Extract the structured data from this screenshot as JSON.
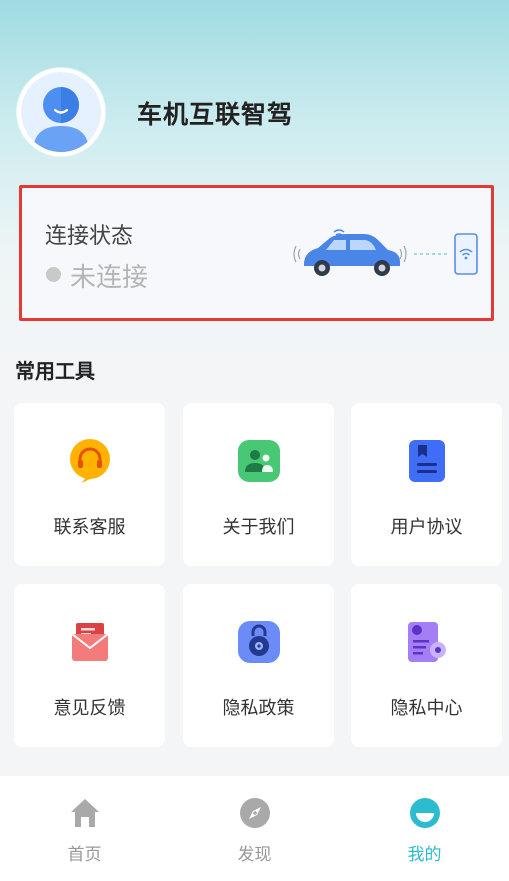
{
  "header": {
    "app_title": "车机互联智驾",
    "avatar_icon": "user-avatar-icon"
  },
  "connection": {
    "title": "连接状态",
    "status": "未连接",
    "status_color": "#c9c9c9"
  },
  "tools": {
    "section_title": "常用工具",
    "items": [
      {
        "label": "联系客服",
        "icon": "headset-icon",
        "color": "#ffb300"
      },
      {
        "label": "关于我们",
        "icon": "people-icon",
        "color": "#3fbf6f"
      },
      {
        "label": "用户协议",
        "icon": "bookmark-document-icon",
        "color": "#3f6df6"
      },
      {
        "label": "意见反馈",
        "icon": "envelope-icon",
        "color": "#f05454"
      },
      {
        "label": "隐私政策",
        "icon": "lock-icon",
        "color": "#5b7cf6"
      },
      {
        "label": "隐私中心",
        "icon": "privacy-settings-icon",
        "color": "#9a6ff2"
      }
    ]
  },
  "nav": {
    "items": [
      {
        "label": "首页",
        "icon": "home-icon"
      },
      {
        "label": "发现",
        "icon": "compass-icon"
      },
      {
        "label": "我的",
        "icon": "profile-face-icon",
        "active": true
      }
    ],
    "active_color": "#2bbdcf",
    "inactive_color": "#999999"
  }
}
